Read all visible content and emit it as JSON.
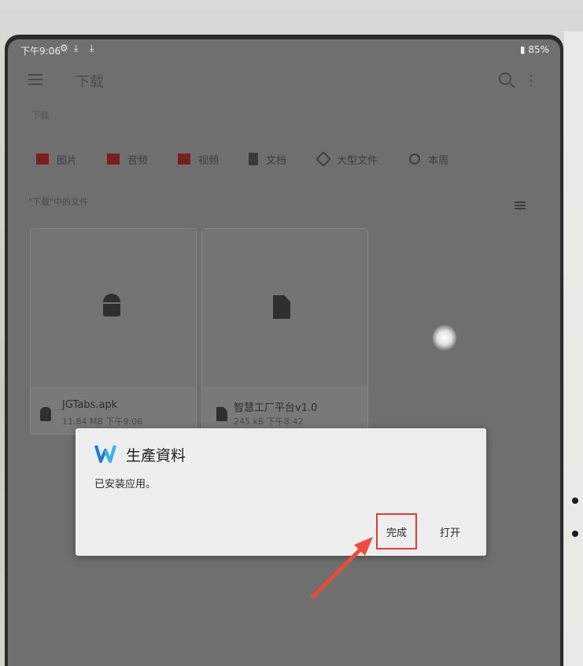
{
  "status_bar": {
    "time": "下午9:06",
    "right": "85%"
  },
  "app_bar": {
    "title": "下载"
  },
  "breadcrumb": "下载",
  "categories": [
    {
      "label": "图片",
      "icon": "image-icon"
    },
    {
      "label": "音频",
      "icon": "audio-icon"
    },
    {
      "label": "视频",
      "icon": "video-icon"
    },
    {
      "label": "文档",
      "icon": "document-icon"
    },
    {
      "label": "大型文件",
      "icon": "tag-icon"
    },
    {
      "label": "本周",
      "icon": "clock-icon"
    }
  ],
  "section_title": "\"下载\"中的文件",
  "files": [
    {
      "name": "JGTabs.apk",
      "meta": "11.84 MB 下午9:06",
      "icon": "android-icon"
    },
    {
      "name": "智慧工厂平台v1.0",
      "meta": "245 kB 下午8:42",
      "icon": "document-icon"
    }
  ],
  "dialog": {
    "title": "生產資料",
    "message": "已安装应用。",
    "done_label": "完成",
    "open_label": "打开"
  },
  "colors": {
    "highlight": "#e53935",
    "arrow": "#f04a3a"
  }
}
